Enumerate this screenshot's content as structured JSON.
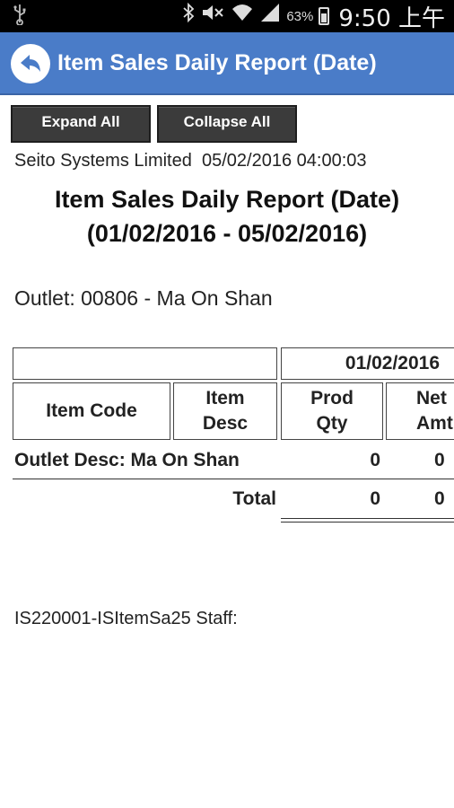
{
  "status_bar": {
    "usb_icon": "usb-icon",
    "bluetooth_icon": "bluetooth-icon",
    "mute_icon": "mute-icon",
    "wifi_icon": "wifi-icon",
    "signal_icon": "signal-icon",
    "battery_percent": "63%",
    "time": "9:50 上午"
  },
  "app_bar": {
    "title": "Item Sales Daily Report (Date)",
    "back_icon": "back-arrow-icon",
    "color": "#4a7cc8"
  },
  "toolbar": {
    "expand_label": "Expand All",
    "collapse_label": "Collapse All"
  },
  "report": {
    "company": "Seito Systems Limited",
    "generated_at": "05/02/2016 04:00:03",
    "title_line1": "Item Sales Daily Report (Date)",
    "title_line2": "(01/02/2016 - 05/02/2016)",
    "outlet": "Outlet: 00806 - Ma On Shan",
    "table": {
      "date_header": "01/02/2016",
      "columns": {
        "item_code": "Item Code",
        "item_desc_1": "Item",
        "item_desc_2": "Desc",
        "prod_qty_1": "Prod",
        "prod_qty_2": "Qty",
        "net_amt_1": "Net",
        "net_amt_2": "Amt"
      },
      "rows": [
        {
          "label": "Outlet Desc: Ma On Shan",
          "prod_qty": "0",
          "net_amt": "0"
        }
      ],
      "total": {
        "label": "Total",
        "prod_qty": "0",
        "net_amt": "0"
      }
    },
    "footer": "IS220001-ISItemSa25 Staff:"
  }
}
